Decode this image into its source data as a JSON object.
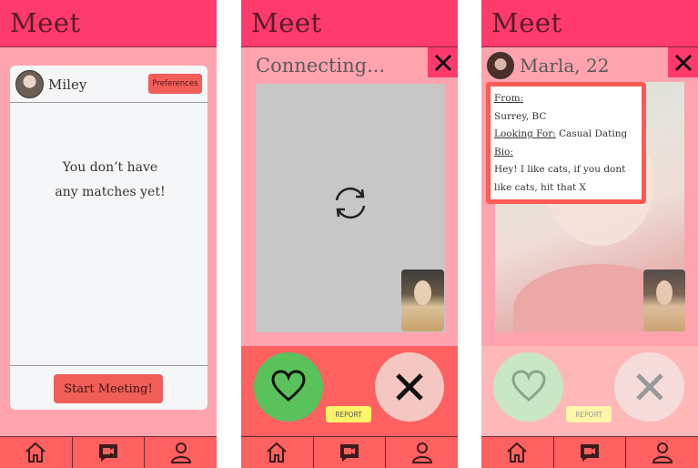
{
  "app": {
    "title": "Meet"
  },
  "screen1": {
    "user_name": "Miley",
    "preferences_label": "Preferences",
    "empty_line1": "You don’t have",
    "empty_line2": "any matches yet!",
    "start_label": "Start Meeting!"
  },
  "screen2": {
    "status": "Connecting...",
    "report_label": "REPORT"
  },
  "screen3": {
    "match_name": "Marla, 22",
    "from_label": "From:",
    "from_value": "Surrey, BC",
    "looking_label": "Looking For:",
    "looking_value": " Casual Dating",
    "bio_label": "Bio:",
    "bio_line1": "Hey! I like cats, if you dont",
    "bio_line2": "like cats, hit that X",
    "report_label": "REPORT"
  },
  "nav": {
    "icons": [
      "home-icon",
      "video-icon",
      "profile-icon"
    ]
  },
  "colors": {
    "header": "#ff3a6c",
    "background": "#ffa3af",
    "accent": "#f15e58",
    "like": "#59c25a",
    "report": "#fff46a"
  }
}
